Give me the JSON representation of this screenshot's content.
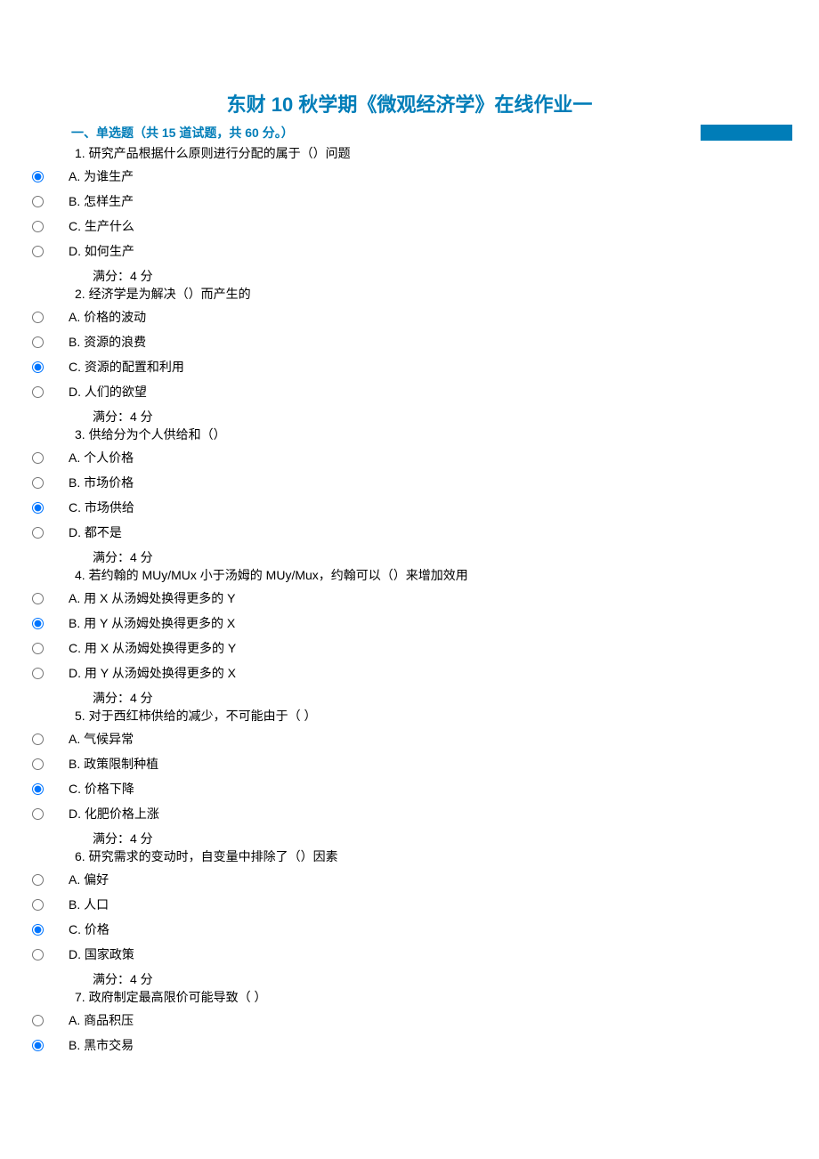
{
  "title": "东财 10 秋学期《微观经济学》在线作业一",
  "section_header": "一、单选题（共 15 道试题，共 60 分。）",
  "score_text": "满分：4  分",
  "questions": [
    {
      "num": "1",
      "text": "1.  研究产品根据什么原则进行分配的属于（）问题",
      "options": [
        {
          "label": "A.  为谁生产",
          "checked": true
        },
        {
          "label": "B.  怎样生产",
          "checked": false
        },
        {
          "label": "C.  生产什么",
          "checked": false
        },
        {
          "label": "D.  如何生产",
          "checked": false
        }
      ]
    },
    {
      "num": "2",
      "text": "2.  经济学是为解决（）而产生的",
      "options": [
        {
          "label": "A.  价格的波动",
          "checked": false
        },
        {
          "label": "B.  资源的浪费",
          "checked": false
        },
        {
          "label": "C.  资源的配置和利用",
          "checked": true
        },
        {
          "label": "D.  人们的欲望",
          "checked": false
        }
      ]
    },
    {
      "num": "3",
      "text": "3.  供给分为个人供给和（）",
      "options": [
        {
          "label": "A.  个人价格",
          "checked": false
        },
        {
          "label": "B.  市场价格",
          "checked": false
        },
        {
          "label": "C.  市场供给",
          "checked": true
        },
        {
          "label": "D.  都不是",
          "checked": false
        }
      ]
    },
    {
      "num": "4",
      "text": "4.  若约翰的 MUy/MUx 小于汤姆的 MUy/Mux，约翰可以（）来增加效用",
      "options": [
        {
          "label": "A.  用 X 从汤姆处换得更多的 Y",
          "checked": false
        },
        {
          "label": "B.  用 Y 从汤姆处换得更多的 X",
          "checked": true
        },
        {
          "label": "C.  用 X 从汤姆处换得更多的 Y",
          "checked": false
        },
        {
          "label": "D.  用 Y 从汤姆处换得更多的 X",
          "checked": false
        }
      ]
    },
    {
      "num": "5",
      "text": "5.  对于西红柿供给的减少，不可能由于（  ）",
      "options": [
        {
          "label": "A.  气候异常",
          "checked": false
        },
        {
          "label": "B.  政策限制种植",
          "checked": false
        },
        {
          "label": "C.  价格下降",
          "checked": true
        },
        {
          "label": "D.  化肥价格上涨",
          "checked": false
        }
      ]
    },
    {
      "num": "6",
      "text": "6.  研究需求的变动时，自变量中排除了（）因素",
      "options": [
        {
          "label": "A.  偏好",
          "checked": false
        },
        {
          "label": "B.  人口",
          "checked": false
        },
        {
          "label": "C.  价格",
          "checked": true
        },
        {
          "label": "D.  国家政策",
          "checked": false
        }
      ]
    },
    {
      "num": "7",
      "text": "7.  政府制定最高限价可能导致（  ）",
      "options": [
        {
          "label": "A.  商品积压",
          "checked": false
        },
        {
          "label": "B.  黑市交易",
          "checked": true
        }
      ]
    }
  ]
}
